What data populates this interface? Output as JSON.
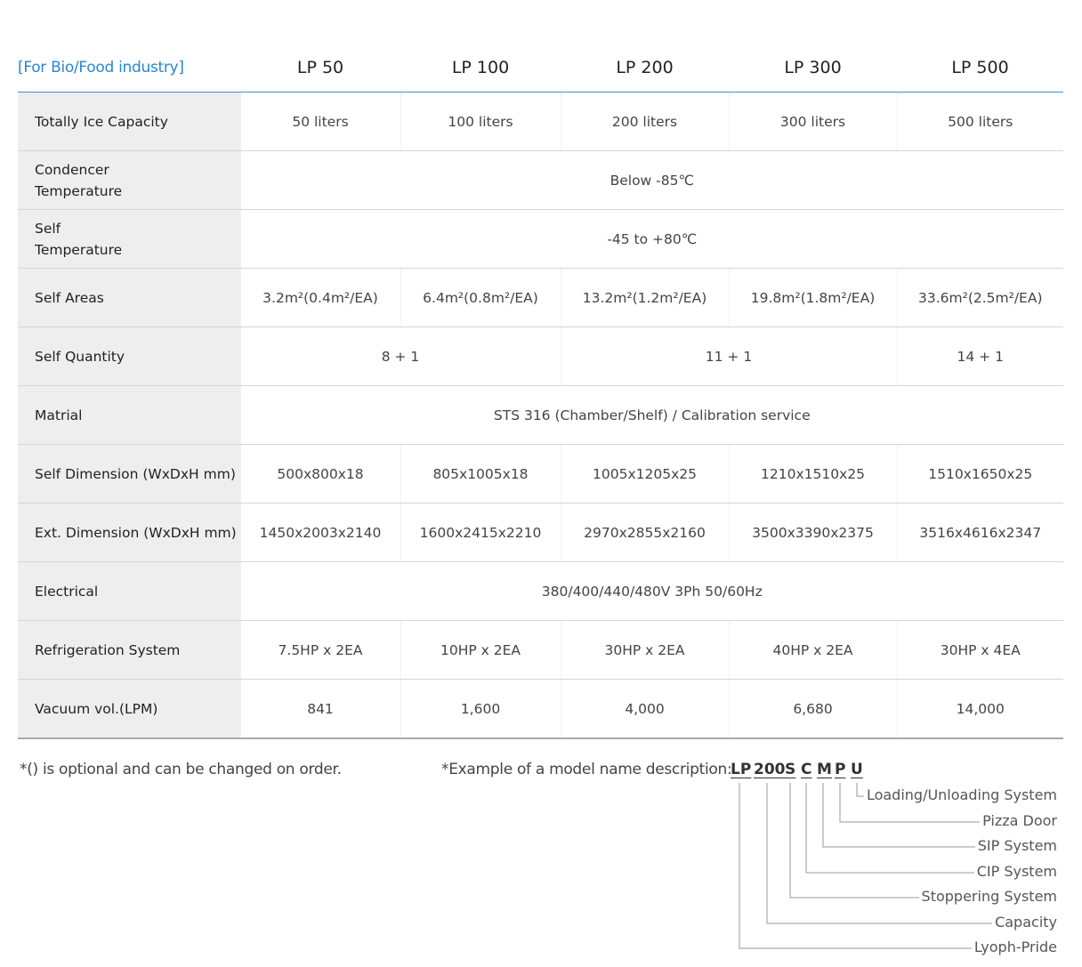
{
  "table": {
    "corner_label": "[For Bio/Food industry]",
    "models": [
      "LP 50",
      "LP 100",
      "LP 200",
      "LP 300",
      "LP 500"
    ],
    "rows": {
      "ice_capacity": {
        "label": "Totally Ice Capacity",
        "values": [
          "50 liters",
          "100 liters",
          "200 liters",
          "300 liters",
          "500 liters"
        ]
      },
      "condencer_temp": {
        "label_line1": "Condencer",
        "label_line2": "Temperature",
        "value": "Below -85℃"
      },
      "self_temp": {
        "label_line1": "Self",
        "label_line2": "Temperature",
        "value": "-45 to +80℃"
      },
      "self_areas": {
        "label": "Self Areas",
        "values": [
          "3.2m²(0.4m²/EA)",
          "6.4m²(0.8m²/EA)",
          "13.2m²(1.2m²/EA)",
          "19.8m²(1.8m²/EA)",
          "33.6m²(2.5m²/EA)"
        ]
      },
      "self_quantity": {
        "label": "Self Quantity",
        "values": [
          "8 + 1",
          "11 + 1",
          "14 + 1"
        ]
      },
      "matrial": {
        "label": "Matrial",
        "value": "STS 316 (Chamber/Shelf) / Calibration service"
      },
      "self_dimension": {
        "label": "Self Dimension (WxDxH mm)",
        "values": [
          "500x800x18",
          "805x1005x18",
          "1005x1205x25",
          "1210x1510x25",
          "1510x1650x25"
        ]
      },
      "ext_dimension": {
        "label": "Ext. Dimension (WxDxH mm)",
        "values": [
          "1450x2003x2140",
          "1600x2415x2210",
          "2970x2855x2160",
          "3500x3390x2375",
          "3516x4616x2347"
        ]
      },
      "electrical": {
        "label": "Electrical",
        "value": "380/400/440/480V 3Ph 50/60Hz"
      },
      "refrigeration": {
        "label": "Refrigeration System",
        "values": [
          "7.5HP x 2EA",
          "10HP x 2EA",
          "30HP x 2EA",
          "40HP x 2EA",
          "30HP x 4EA"
        ]
      },
      "vacuum": {
        "label": "Vacuum vol.(LPM)",
        "values": [
          "841",
          "1,600",
          "4,000",
          "6,680",
          "14,000"
        ]
      }
    }
  },
  "notes": {
    "optional": "*() is optional and can be changed on order.",
    "example_prefix": "*Example of a model name description:"
  },
  "model_code": {
    "parts": [
      "LP",
      "200",
      "S",
      "C",
      "M",
      "P",
      "U"
    ],
    "legend": [
      "Loading/Unloading System",
      "Pizza Door",
      "SIP System",
      "CIP System",
      "Stoppering System",
      "Capacity",
      "Lyoph-Pride"
    ]
  },
  "colors": {
    "accent": "#2a86d4",
    "label_bg": "#eeeeee",
    "row_border": "#d5d5d5",
    "leader_line": "#999999"
  }
}
